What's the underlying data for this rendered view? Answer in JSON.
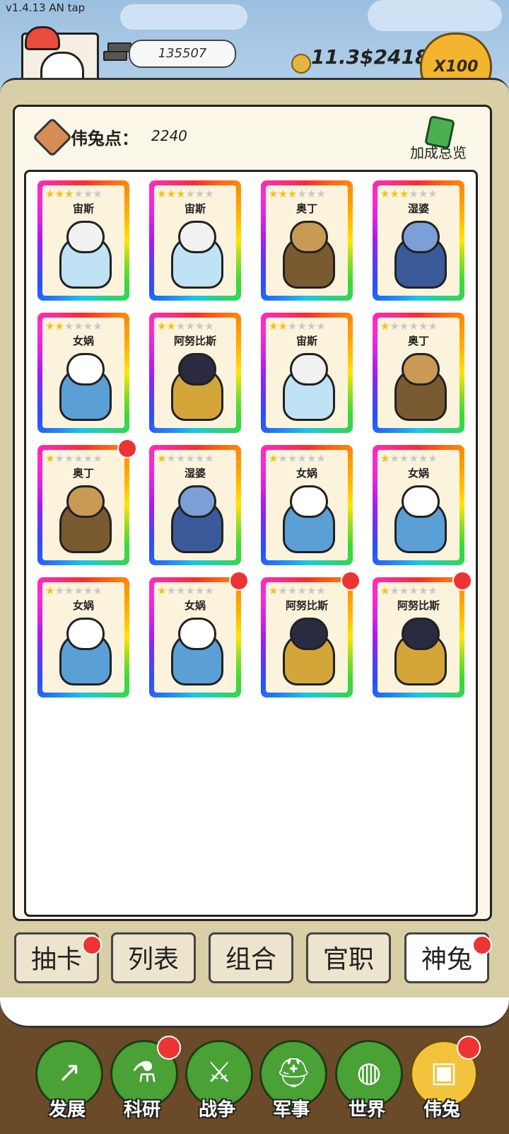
{
  "version": "v1.4.13 AN tap",
  "header": {
    "resource_value": "135507",
    "money": "11.3$2418",
    "multiplier": "X100"
  },
  "panel": {
    "points_label": "伟兔点：",
    "points_value": "2240",
    "bonus_label": "加成总览"
  },
  "cards": [
    {
      "name": "宙斯",
      "stars": 3
    },
    {
      "name": "宙斯",
      "stars": 3
    },
    {
      "name": "奥丁",
      "stars": 3
    },
    {
      "name": "湿婆",
      "stars": 3
    },
    {
      "name": "女娲",
      "stars": 2
    },
    {
      "name": "阿努比斯",
      "stars": 2
    },
    {
      "name": "宙斯",
      "stars": 2
    },
    {
      "name": "奥丁",
      "stars": 1
    },
    {
      "name": "奥丁",
      "stars": 1
    },
    {
      "name": "湿婆",
      "stars": 1
    },
    {
      "name": "女娲",
      "stars": 1
    },
    {
      "name": "女娲",
      "stars": 1
    },
    {
      "name": "女娲",
      "stars": 1
    },
    {
      "name": "女娲",
      "stars": 1
    },
    {
      "name": "阿努比斯",
      "stars": 1
    },
    {
      "name": "阿努比斯",
      "stars": 1
    }
  ],
  "tabs": [
    {
      "label": "抽卡"
    },
    {
      "label": "列表"
    },
    {
      "label": "组合"
    },
    {
      "label": "官职"
    },
    {
      "label": "神兔"
    }
  ],
  "nav": [
    {
      "label": "发展"
    },
    {
      "label": "科研"
    },
    {
      "label": "战争"
    },
    {
      "label": "军事"
    },
    {
      "label": "世界"
    },
    {
      "label": "伟兔"
    }
  ],
  "colors": {
    "panel_bg": "#fbf7e8",
    "nav_green": "#4aa136",
    "nav_active": "#f4c33e",
    "star_on": "#f2c21b",
    "notify_red": "#ee3333"
  }
}
